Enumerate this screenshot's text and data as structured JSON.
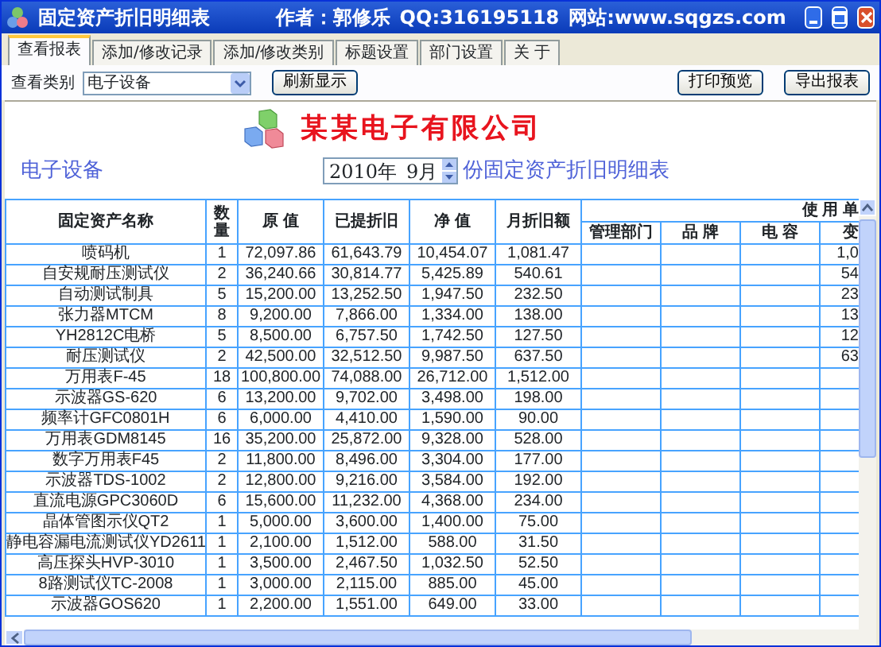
{
  "window": {
    "title": "固定资产折旧明细表",
    "author": "作者：郭修乐",
    "qq": "QQ:316195118",
    "website": "网站:www.sqgzs.com"
  },
  "tabs": [
    {
      "label": "查看报表",
      "selected": true
    },
    {
      "label": "添加/修改记录",
      "selected": false
    },
    {
      "label": "添加/修改类别",
      "selected": false
    },
    {
      "label": "标题设置",
      "selected": false
    },
    {
      "label": "部门设置",
      "selected": false
    },
    {
      "label": "关 于",
      "selected": false
    }
  ],
  "toolbar": {
    "category_label": "查看类别",
    "category_value": "电子设备",
    "refresh_button": "刷新显示",
    "right_buttons": [
      "打印预览",
      "导出报表"
    ]
  },
  "report": {
    "company": "某某电子有限公司",
    "category": "电子设备",
    "year": "2010年",
    "month": "9月",
    "title_suffix": "份固定资产折旧明细表"
  },
  "table": {
    "columns": [
      "固定资产名称",
      "数量",
      "原 值",
      "已提折旧",
      "净 值",
      "月折旧额"
    ],
    "group_header": "使 用 单",
    "sub_columns": [
      "管理部门",
      "品 牌",
      "电 容",
      "变"
    ],
    "rows": [
      {
        "name": "喷码机",
        "qty": "1",
        "original": "72,097.86",
        "accumulated": "61,643.79",
        "net": "10,454.07",
        "monthly": "1,081.47",
        "column_10": "1,0"
      },
      {
        "name": "自安规耐压测试仪",
        "qty": "2",
        "original": "36,240.66",
        "accumulated": "30,814.77",
        "net": "5,425.89",
        "monthly": "540.61",
        "column_10": "54"
      },
      {
        "name": "自动测试制具",
        "qty": "5",
        "original": "15,200.00",
        "accumulated": "13,252.50",
        "net": "1,947.50",
        "monthly": "232.50",
        "column_10": "23"
      },
      {
        "name": "张力器MTCM",
        "qty": "8",
        "original": "9,200.00",
        "accumulated": "7,866.00",
        "net": "1,334.00",
        "monthly": "138.00",
        "column_10": "13"
      },
      {
        "name": "YH2812C电桥",
        "qty": "5",
        "original": "8,500.00",
        "accumulated": "6,757.50",
        "net": "1,742.50",
        "monthly": "127.50",
        "column_10": "12"
      },
      {
        "name": "耐压测试仪",
        "qty": "2",
        "original": "42,500.00",
        "accumulated": "32,512.50",
        "net": "9,987.50",
        "monthly": "637.50",
        "column_10": "63"
      },
      {
        "name": "万用表F-45",
        "qty": "18",
        "original": "100,800.00",
        "accumulated": "74,088.00",
        "net": "26,712.00",
        "monthly": "1,512.00"
      },
      {
        "name": "示波器GS-620",
        "qty": "6",
        "original": "13,200.00",
        "accumulated": "9,702.00",
        "net": "3,498.00",
        "monthly": "198.00"
      },
      {
        "name": "频率计GFC0801H",
        "qty": "6",
        "original": "6,000.00",
        "accumulated": "4,410.00",
        "net": "1,590.00",
        "monthly": "90.00"
      },
      {
        "name": "万用表GDM8145",
        "qty": "16",
        "original": "35,200.00",
        "accumulated": "25,872.00",
        "net": "9,328.00",
        "monthly": "528.00"
      },
      {
        "name": "数字万用表F45",
        "qty": "2",
        "original": "11,800.00",
        "accumulated": "8,496.00",
        "net": "3,304.00",
        "monthly": "177.00"
      },
      {
        "name": "示波器TDS-1002",
        "qty": "2",
        "original": "12,800.00",
        "accumulated": "9,216.00",
        "net": "3,584.00",
        "monthly": "192.00"
      },
      {
        "name": "直流电源GPC3060D",
        "qty": "6",
        "original": "15,600.00",
        "accumulated": "11,232.00",
        "net": "4,368.00",
        "monthly": "234.00"
      },
      {
        "name": "晶体管图示仪QT2",
        "qty": "1",
        "original": "5,000.00",
        "accumulated": "3,600.00",
        "net": "1,400.00",
        "monthly": "75.00"
      },
      {
        "name": "静电容漏电流测试仪YD2611",
        "qty": "1",
        "original": "2,100.00",
        "accumulated": "1,512.00",
        "net": "588.00",
        "monthly": "31.50"
      },
      {
        "name": "高压探头HVP-3010",
        "qty": "1",
        "original": "3,500.00",
        "accumulated": "2,467.50",
        "net": "1,032.50",
        "monthly": "52.50"
      },
      {
        "name": "8路测试仪TC-2008",
        "qty": "1",
        "original": "3,000.00",
        "accumulated": "2,115.00",
        "net": "885.00",
        "monthly": "45.00"
      },
      {
        "name": "示波器GOS620",
        "qty": "1",
        "original": "2,200.00",
        "accumulated": "1,551.00",
        "net": "649.00",
        "monthly": "33.00"
      }
    ]
  }
}
